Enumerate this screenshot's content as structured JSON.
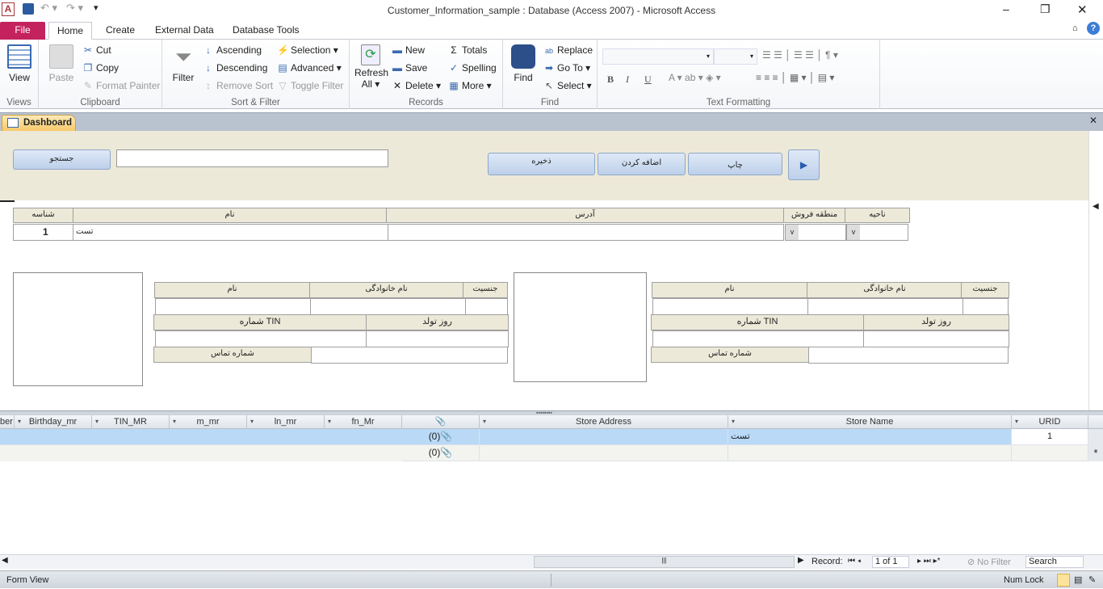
{
  "window": {
    "title": "Customer_Information_sample : Database (Access 2007)  -  Microsoft Access",
    "app_icon": "A",
    "controls": {
      "minimize": "–",
      "restore": "❐",
      "close": "✕"
    }
  },
  "tabs": [
    "File",
    "Home",
    "Create",
    "External Data",
    "Database Tools"
  ],
  "ribbon": {
    "views": {
      "label": "Views",
      "view": "View"
    },
    "clipboard": {
      "label": "Clipboard",
      "paste": "Paste",
      "cut": "Cut",
      "copy": "Copy",
      "format_painter": "Format Painter"
    },
    "sort_filter": {
      "label": "Sort & Filter",
      "filter": "Filter",
      "ascending": "Ascending",
      "descending": "Descending",
      "remove_sort": "Remove Sort",
      "selection": "Selection ▾",
      "advanced": "Advanced ▾",
      "toggle_filter": "Toggle Filter"
    },
    "records": {
      "label": "Records",
      "refresh": "Refresh",
      "refresh_all": "All ▾",
      "new": "New",
      "save": "Save",
      "delete": "Delete ▾",
      "totals": "Totals",
      "spelling": "Spelling",
      "more": "More ▾"
    },
    "find": {
      "label": "Find",
      "find": "Find",
      "replace": "Replace",
      "goto": "Go To ▾",
      "select": "Select ▾"
    },
    "text_formatting": {
      "label": "Text Formatting",
      "bold": "B",
      "italic": "I",
      "underline": "U"
    }
  },
  "document_tab": {
    "label": "Dashboard"
  },
  "form": {
    "header": {
      "search_button": "جستجو",
      "search_value": "",
      "save_button": "ذخیره",
      "add_button": "اضافه کردن",
      "print_button": "چاپ"
    },
    "main_labels": {
      "id": "شناسه",
      "name": "نام",
      "address": "آدرس",
      "sales_region": "منطقه فروش",
      "area": "ناحیه"
    },
    "main_values": {
      "id": "1",
      "name": "تست",
      "address": "",
      "sales_region": "",
      "area": ""
    },
    "person_labels": {
      "first_name": "نام",
      "last_name": "نام خانوادگی",
      "gender": "جنسیت",
      "tin": "شماره TIN",
      "birthday": "روز تولد",
      "phone": "شماره تماس"
    }
  },
  "datasheet": {
    "columns": [
      "ber",
      "Birthday_mr",
      "TIN_MR",
      "m_mr",
      "ln_mr",
      "fn_Mr",
      "📎",
      "Store Address",
      "Store Name",
      "URID"
    ],
    "rows": [
      {
        "attachment": "(0)",
        "store_address": "",
        "store_name": "تست",
        "urid": "1"
      },
      {
        "attachment": "(0)",
        "store_address": "",
        "store_name": "",
        "urid": ""
      }
    ],
    "new_row_marker": "*",
    "selected_row_color": "#b9d9f7"
  },
  "navigation": {
    "record_label": "Record:",
    "position": "1 of 1",
    "no_filter": "No Filter",
    "search": "Search"
  },
  "statusbar": {
    "view": "Form View",
    "num_lock": "Num Lock"
  }
}
